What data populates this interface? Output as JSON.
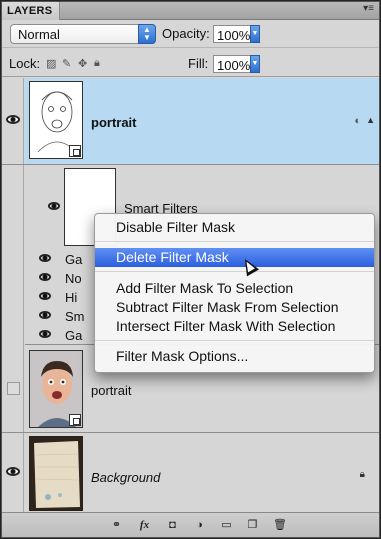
{
  "panel": {
    "tab_label": "LAYERS",
    "blend_mode": "Normal",
    "opacity_label": "Opacity:",
    "opacity_value": "100%",
    "lock_label": "Lock:",
    "fill_label": "Fill:",
    "fill_value": "100%"
  },
  "layers": [
    {
      "name": "portrait",
      "selected": true,
      "visible": true,
      "smart_object": true
    },
    {
      "name": "Smart Filters",
      "visible": true
    },
    {
      "name": "portrait",
      "selected": false,
      "visible": false,
      "smart_object": true
    },
    {
      "name": "Background",
      "selected": false,
      "visible": true,
      "locked": true
    }
  ],
  "smart_filters": [
    {
      "name": "Ga"
    },
    {
      "name": "No"
    },
    {
      "name": "Hi"
    },
    {
      "name": "Sm"
    },
    {
      "name": "Ga"
    }
  ],
  "context_menu": {
    "items": [
      {
        "label": "Disable Filter Mask"
      },
      {
        "label": "Delete Filter Mask",
        "highlighted": true
      },
      {
        "label": "Add Filter Mask To Selection"
      },
      {
        "label": "Subtract Filter Mask From Selection"
      },
      {
        "label": "Intersect Filter Mask With Selection"
      },
      {
        "label": "Filter Mask Options..."
      }
    ]
  },
  "bottom_bar": {
    "fx_label": "fx"
  },
  "colors": {
    "selection": "#b8d9f2",
    "menu_highlight": "#3a6ee3",
    "panel_bg": "#d6d6d6"
  }
}
